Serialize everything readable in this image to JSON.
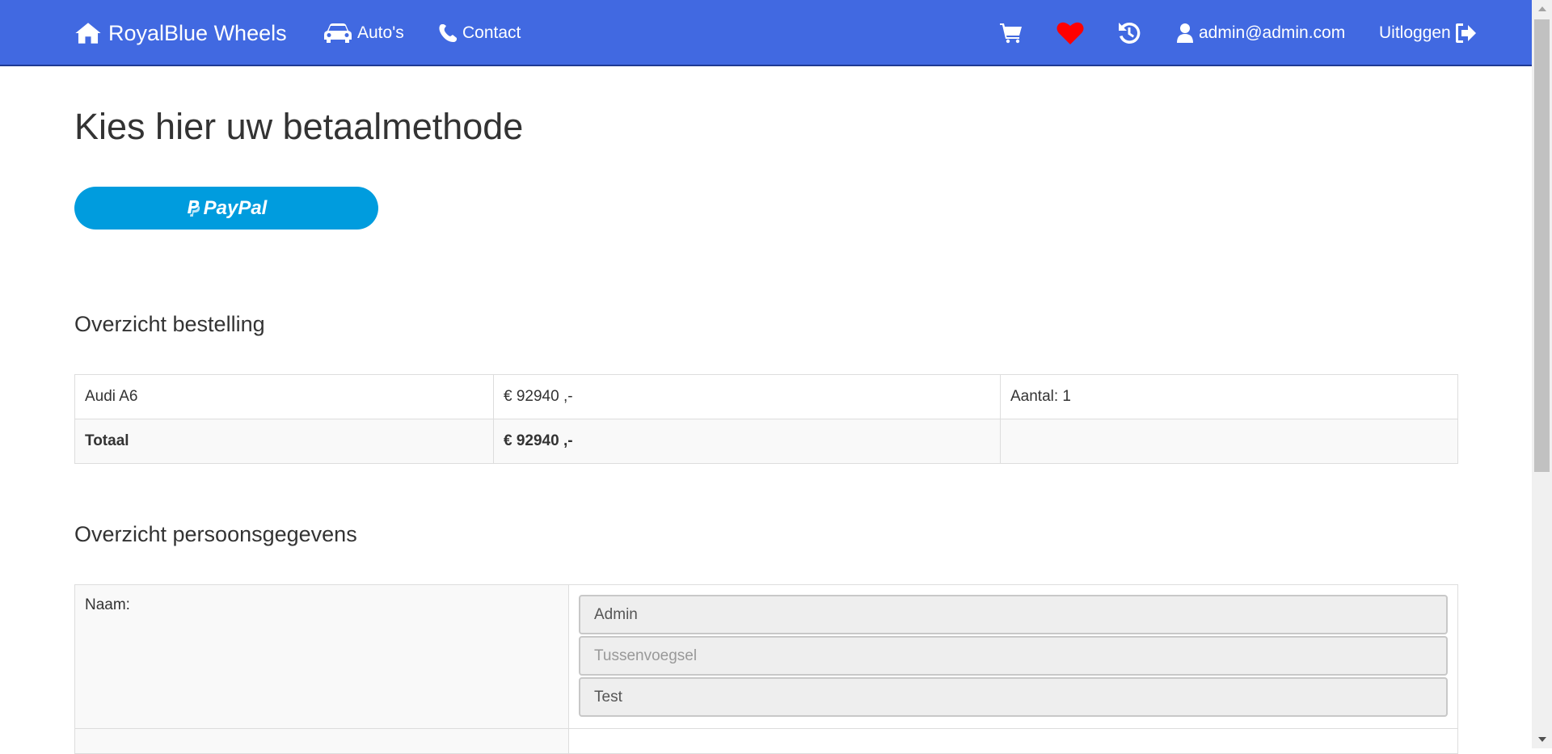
{
  "nav": {
    "brand": "RoyalBlue Wheels",
    "autos": "Auto's",
    "contact": "Contact",
    "user_email": "admin@admin.com",
    "logout": "Uitloggen",
    "heart_color": "#ff0000",
    "bg_color": "#4169e1"
  },
  "page": {
    "title": "Kies hier uw betaalmethode",
    "paypal_label": "PayPal",
    "paypal_color": "#009cde"
  },
  "order": {
    "title": "Overzicht bestelling",
    "rows": [
      {
        "name": "Audi A6",
        "price": "€ 92940 ,-",
        "qty": "Aantal: 1"
      }
    ],
    "total_label": "Totaal",
    "total_value": "€ 92940 ,-"
  },
  "personal": {
    "title": "Overzicht persoonsgegevens",
    "name_label": "Naam:",
    "first_name": "Admin",
    "infix_placeholder": "Tussenvoegsel",
    "last_name": "Test"
  }
}
